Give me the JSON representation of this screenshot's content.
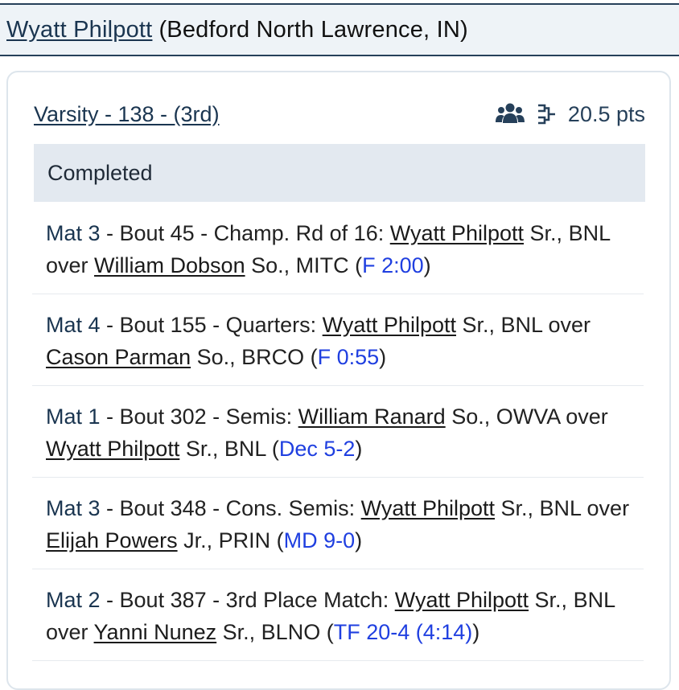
{
  "header": {
    "wrestler_name": "Wyatt Philpott",
    "school": "(Bedford North Lawrence, IN)"
  },
  "card": {
    "division": "Varsity - 138 - (3rd)",
    "points": "20.5 pts",
    "team_icon": "users-icon",
    "bracket_icon": "bracket-icon"
  },
  "section": {
    "title": "Completed"
  },
  "matches": [
    {
      "mat": "Mat 3",
      "desc": " - Bout 45 - Champ. Rd of 16: ",
      "winner": "Wyatt Philpott",
      "winner_info": " Sr., BNL over ",
      "loser": "William Dobson",
      "loser_info": " So., MITC (",
      "result": "F 2:00",
      "close": ")"
    },
    {
      "mat": "Mat 4",
      "desc": " - Bout 155 - Quarters: ",
      "winner": "Wyatt Philpott",
      "winner_info": " Sr., BNL over ",
      "loser": "Cason Parman",
      "loser_info": " So., BRCO (",
      "result": "F 0:55",
      "close": ")"
    },
    {
      "mat": "Mat 1",
      "desc": " - Bout 302 - Semis: ",
      "winner": "William Ranard",
      "winner_info": " So., OWVA over ",
      "loser": "Wyatt Philpott",
      "loser_info": " Sr., BNL (",
      "result": "Dec 5-2",
      "close": ")"
    },
    {
      "mat": "Mat 3",
      "desc": " - Bout 348 - Cons. Semis: ",
      "winner": "Wyatt Philpott",
      "winner_info": " Sr., BNL over ",
      "loser": "Elijah Powers",
      "loser_info": " Jr., PRIN (",
      "result": "MD 9-0",
      "close": ")"
    },
    {
      "mat": "Mat 2",
      "desc": " - Bout 387 - 3rd Place Match: ",
      "winner": "Wyatt Philpott",
      "winner_info": " Sr., BNL over ",
      "loser": "Yanni Nunez",
      "loser_info": " Sr., BLNO (",
      "result": "TF 20-4 (4:14)",
      "close": ")"
    }
  ]
}
